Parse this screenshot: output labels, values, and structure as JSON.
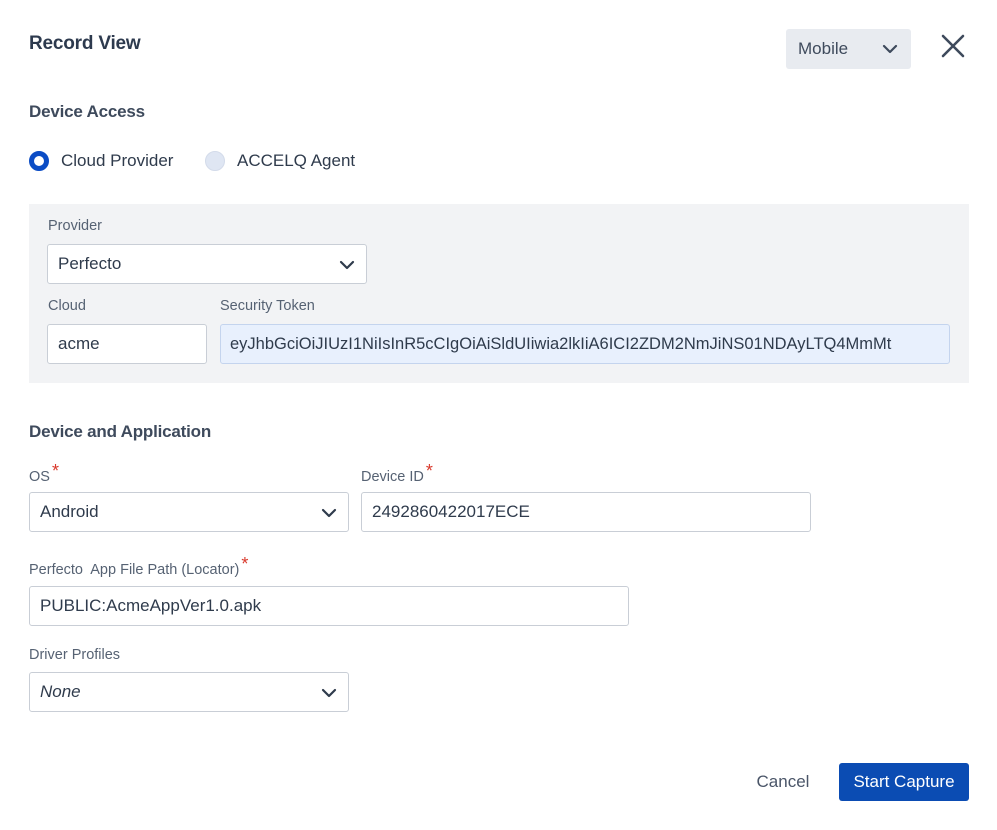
{
  "header": {
    "title": "Record View",
    "mode_select": {
      "value": "Mobile",
      "icon": "chevron-down-icon"
    },
    "close_icon": "close-icon"
  },
  "device_access": {
    "heading": "Device Access",
    "options": [
      {
        "label": "Cloud Provider",
        "selected": true
      },
      {
        "label": "ACCELQ Agent",
        "selected": false
      }
    ],
    "provider": {
      "label": "Provider",
      "value": "Perfecto"
    },
    "cloud": {
      "label": "Cloud",
      "value": "acme"
    },
    "security_token": {
      "label": "Security Token",
      "value": "eyJhbGciOiJIUzI1NiIsInR5cCIgOiAiSldUIiwia2lkIiA6ICI2ZDM2NmJiNS01NDAyLTQ4MmMt"
    }
  },
  "device_application": {
    "heading": "Device and Application",
    "os": {
      "label": "OS",
      "required_mark": "*",
      "value": "Android"
    },
    "device_id": {
      "label": "Device ID",
      "required_mark": "*",
      "value": "2492860422017ECE"
    },
    "app_file_path": {
      "label": "Perfecto  App File Path (Locator)",
      "required_mark": "*",
      "value": "PUBLIC:AcmeAppVer1.0.apk"
    },
    "driver_profiles": {
      "label": "Driver Profiles",
      "value": "None"
    }
  },
  "footer": {
    "cancel_label": "Cancel",
    "start_label": "Start Capture"
  },
  "colors": {
    "primary": "#0b4cb3",
    "required": "#d9382b",
    "panel_bg": "#f2f3f5",
    "token_bg": "#e8f0fd"
  }
}
